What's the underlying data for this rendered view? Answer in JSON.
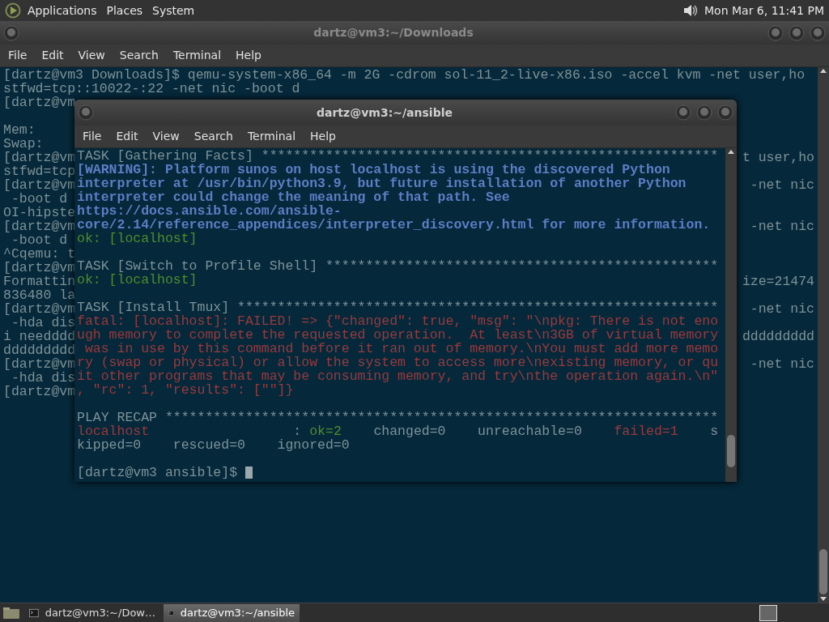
{
  "top_panel": {
    "menus": [
      "Applications",
      "Places",
      "System"
    ],
    "clock": "Mon Mar 6, 11:41 PM"
  },
  "back_window": {
    "title": "dartz@vm3:~/Downloads",
    "active": false,
    "menu": [
      "File",
      "Edit",
      "View",
      "Search",
      "Terminal",
      "Help"
    ],
    "blocks": [
      [
        {
          "left": "[dartz@vm3 Downloads]$ qemu-system-x86_64 -m 2G -cdrom sol-11_2-live-x86.iso -accel kvm -net user,ho"
        },
        {
          "left": "stfwd=tcp::10022-:22 -net nic -boot d"
        },
        {
          "left": "[dartz@vm"
        }
      ],
      [
        {
          "left": "Mem:"
        },
        {
          "left": "Swap:"
        },
        {
          "left": "[dartz@vm",
          "right": "t user,ho"
        },
        {
          "left": "stfwd=tcp"
        },
        {
          "left": "[dartz@vm",
          "right": "-net nic"
        },
        {
          "left": " -boot d"
        },
        {
          "left": "OI-hipste"
        },
        {
          "left": "[dartz@vm",
          "right": "-net nic"
        },
        {
          "left": " -boot d"
        },
        {
          "left": "^Cqemu: t"
        },
        {
          "left": "[dartz@vm"
        },
        {
          "left": "Formattin",
          "right": "ize=21474"
        },
        {
          "left": "836480 la"
        },
        {
          "left": "[dartz@vm",
          "right": "-net nic"
        },
        {
          "left": " -hda dis"
        },
        {
          "left": "i needddd",
          "right": "ddddddddd"
        },
        {
          "left": "ddddddddd"
        },
        {
          "left": "[dartz@vm",
          "right": "-net nic"
        },
        {
          "left": " -hda dis"
        },
        {
          "left": "[dartz@vm"
        }
      ]
    ]
  },
  "front_window": {
    "title": "dartz@vm3:~/ansible",
    "active": true,
    "menu": [
      "File",
      "Edit",
      "View",
      "Search",
      "Terminal",
      "Help"
    ],
    "blocks": [
      [
        [
          {
            "text": "TASK [Gathering Facts] *********************************************************",
            "kind": "plain"
          }
        ],
        [
          {
            "text": "[WARNING]: Platform sunos on host localhost is using the discovered Python",
            "kind": "warning"
          }
        ],
        [
          {
            "text": "interpreter at /usr/bin/python3.9, but future installation of another Python",
            "kind": "warning"
          }
        ],
        [
          {
            "text": "interpreter could change the meaning of that path. See",
            "kind": "warning"
          }
        ],
        [
          {
            "text": "https://docs.ansible.com/ansible-",
            "kind": "warning"
          }
        ],
        [
          {
            "text": "core/2.14/reference_appendices/interpreter_discovery.html for more information.",
            "kind": "warning"
          }
        ],
        [
          {
            "text": "ok: [localhost]",
            "kind": "ok"
          }
        ]
      ],
      [
        [
          {
            "text": "TASK [Switch to Profile Shell] *************************************************",
            "kind": "plain"
          }
        ],
        [
          {
            "text": "ok: [localhost]",
            "kind": "ok"
          }
        ]
      ],
      [
        [
          {
            "text": "TASK [Install Tmux] ************************************************************",
            "kind": "plain"
          }
        ],
        [
          {
            "text": "fatal: [localhost]: FAILED! => {\"changed\": true, \"msg\": \"\\npkg: There is not eno",
            "kind": "fatal"
          }
        ],
        [
          {
            "text": "ugh memory to complete the requested operation.  At least\\n3GB of virtual memory",
            "kind": "fatal"
          }
        ],
        [
          {
            "text": " was in use by this command before it ran out of memory.\\nYou must add more memo",
            "kind": "fatal"
          }
        ],
        [
          {
            "text": "ry (swap or physical) or allow the system to access more\\nexisting memory, or qu",
            "kind": "fatal"
          }
        ],
        [
          {
            "text": "it other programs that may be consuming memory, and try\\nthe operation again.\\n\"",
            "kind": "fatal"
          }
        ],
        [
          {
            "text": ", \"rc\": 1, \"results\": [\"\"]}",
            "kind": "fatal"
          }
        ]
      ],
      [
        [
          {
            "text": "PLAY RECAP *********************************************************************",
            "kind": "plain"
          }
        ],
        [
          {
            "text": "localhost",
            "kind": "fatal"
          },
          {
            "text": "                  : ",
            "kind": "plain"
          },
          {
            "text": "ok=2",
            "kind": "ok"
          },
          {
            "text": "    changed=0    unreachable=0    ",
            "kind": "plain"
          },
          {
            "text": "failed=1",
            "kind": "fatal"
          },
          {
            "text": "    s",
            "kind": "plain"
          }
        ],
        [
          {
            "text": "kipped=0    rescued=0    ignored=0",
            "kind": "plain"
          }
        ]
      ],
      [
        [
          {
            "text": "[dartz@vm3 ansible]$ ",
            "kind": "prompt"
          }
        ]
      ]
    ]
  },
  "taskbar": {
    "items": [
      {
        "label": "dartz@vm3:~/Dow…",
        "selected": false
      },
      {
        "label": "dartz@vm3:~/ansible",
        "selected": true
      }
    ]
  }
}
